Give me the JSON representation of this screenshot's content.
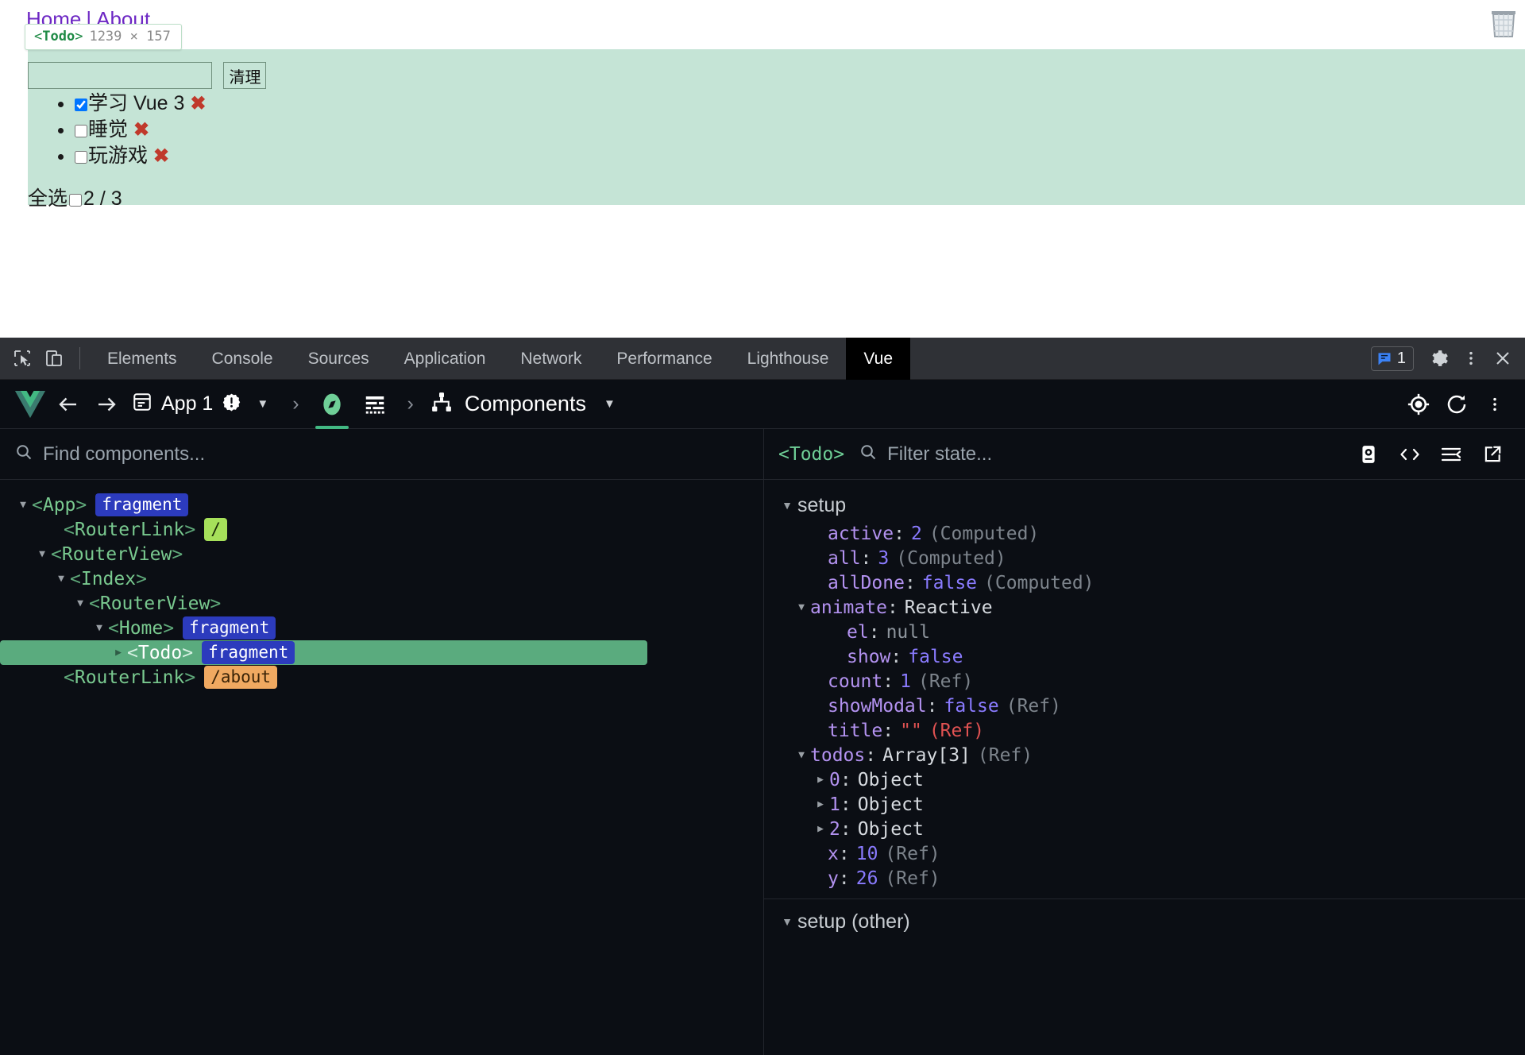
{
  "page": {
    "nav": {
      "home": "Home",
      "separator": "|",
      "about": "About"
    },
    "inspect_tooltip": {
      "tag_open": "<",
      "tag_name": "Todo",
      "tag_close": ">",
      "dimensions": "1239 × 157"
    },
    "todo": {
      "input_value": "",
      "input_placeholder": "",
      "clear_button": "清理",
      "items": [
        {
          "label": "学习 Vue 3",
          "done": true,
          "delete_icon": "✖"
        },
        {
          "label": "睡觉",
          "done": false,
          "delete_icon": "✖"
        },
        {
          "label": "玩游戏",
          "done": false,
          "delete_icon": "✖"
        }
      ],
      "select_all_label": "全选",
      "select_all_checked": false,
      "counter": "2 / 3"
    },
    "trash_icon": "trash-bin-icon",
    "highlight_color": "#c5e4d6"
  },
  "devtools": {
    "tabs": [
      {
        "label": "Elements",
        "active": false
      },
      {
        "label": "Console",
        "active": false
      },
      {
        "label": "Sources",
        "active": false
      },
      {
        "label": "Application",
        "active": false
      },
      {
        "label": "Network",
        "active": false
      },
      {
        "label": "Performance",
        "active": false
      },
      {
        "label": "Lighthouse",
        "active": false
      },
      {
        "label": "Vue",
        "active": true
      }
    ],
    "message_badge_count": "1",
    "icons": {
      "inspect": "cursor-select-icon",
      "device": "device-toolbar-icon",
      "messages": "message-icon",
      "settings": "gear-icon",
      "more": "more-vertical-icon",
      "close": "close-icon"
    }
  },
  "vue": {
    "logo": "vue-logo-icon",
    "back_icon": "arrow-left-icon",
    "forward_icon": "arrow-right-icon",
    "app_icon": "app-window-icon",
    "app_label": "App 1",
    "app_warning_icon": "warning-badge-icon",
    "app_dropdown_icon": "chevron-down-icon",
    "breadcrumb_chevron": "›",
    "compass_icon": "compass-icon",
    "timeline_icon": "timeline-icon",
    "view_icon": "component-tree-icon",
    "view_label": "Components",
    "view_dropdown_icon": "chevron-down-icon",
    "target_icon": "crosshair-target-icon",
    "refresh_icon": "refresh-icon",
    "more_icon": "more-vertical-icon",
    "left": {
      "search_placeholder": "Find components...",
      "search_value": "",
      "search_icon": "search-icon",
      "tree": [
        {
          "depth": 0,
          "caret": "down",
          "name": "App",
          "badge": "fragment",
          "badge_kind": "fragment",
          "selected": false
        },
        {
          "depth": 1,
          "caret": "none",
          "name": "RouterLink",
          "badge": "/",
          "badge_kind": "route-root",
          "selected": false
        },
        {
          "depth": 1,
          "caret": "down",
          "name": "RouterView",
          "badge": "",
          "badge_kind": "",
          "selected": false
        },
        {
          "depth": 2,
          "caret": "down",
          "name": "Index",
          "badge": "",
          "badge_kind": "",
          "selected": false
        },
        {
          "depth": 3,
          "caret": "down",
          "name": "RouterView",
          "badge": "",
          "badge_kind": "",
          "selected": false
        },
        {
          "depth": 4,
          "caret": "down",
          "name": "Home",
          "badge": "fragment",
          "badge_kind": "fragment",
          "selected": false
        },
        {
          "depth": 5,
          "caret": "right",
          "name": "Todo",
          "badge": "fragment",
          "badge_kind": "fragment",
          "selected": true
        },
        {
          "depth": 1,
          "caret": "none",
          "name": "RouterLink",
          "badge": "/about",
          "badge_kind": "route-about",
          "selected": false
        }
      ]
    },
    "right": {
      "selected_component": "<Todo>",
      "filter_placeholder": "Filter state...",
      "filter_value": "",
      "search_icon": "search-icon",
      "actions": [
        {
          "name": "inspect-dom-icon"
        },
        {
          "name": "open-in-editor-code-icon"
        },
        {
          "name": "collapse-all-icon"
        },
        {
          "name": "open-external-icon"
        }
      ],
      "groups": [
        {
          "title": "setup",
          "caret": "down",
          "rows": [
            {
              "depth": 1,
              "caret": "none",
              "key": "active",
              "value": "2",
              "value_kind": "num",
              "meta": "(Computed)",
              "meta_kind": "gray"
            },
            {
              "depth": 1,
              "caret": "none",
              "key": "all",
              "value": "3",
              "value_kind": "num",
              "meta": "(Computed)",
              "meta_kind": "gray"
            },
            {
              "depth": 1,
              "caret": "none",
              "key": "allDone",
              "value": "false",
              "value_kind": "bool",
              "meta": "(Computed)",
              "meta_kind": "gray"
            },
            {
              "depth": 1,
              "caret": "down",
              "key": "animate",
              "value": "Reactive",
              "value_kind": "plain",
              "meta": "",
              "meta_kind": "gray"
            },
            {
              "depth": 2,
              "caret": "none",
              "key": "el",
              "value": "null",
              "value_kind": "null",
              "meta": "",
              "meta_kind": "gray"
            },
            {
              "depth": 2,
              "caret": "none",
              "key": "show",
              "value": "false",
              "value_kind": "bool",
              "meta": "",
              "meta_kind": "gray"
            },
            {
              "depth": 1,
              "caret": "none",
              "key": "count",
              "value": "1",
              "value_kind": "num",
              "meta": "(Ref)",
              "meta_kind": "gray"
            },
            {
              "depth": 1,
              "caret": "none",
              "key": "showModal",
              "value": "false",
              "value_kind": "bool",
              "meta": "(Ref)",
              "meta_kind": "gray"
            },
            {
              "depth": 1,
              "caret": "none",
              "key": "title",
              "value": "\"\"",
              "value_kind": "str",
              "meta": "(Ref)",
              "meta_kind": "red"
            },
            {
              "depth": 1,
              "caret": "down",
              "key": "todos",
              "value": "Array[3]",
              "value_kind": "plain",
              "meta": "(Ref)",
              "meta_kind": "gray"
            },
            {
              "depth": 2,
              "caret": "right",
              "key": "0",
              "value": "Object",
              "value_kind": "plain",
              "meta": "",
              "meta_kind": "gray"
            },
            {
              "depth": 2,
              "caret": "right",
              "key": "1",
              "value": "Object",
              "value_kind": "plain",
              "meta": "",
              "meta_kind": "gray"
            },
            {
              "depth": 2,
              "caret": "right",
              "key": "2",
              "value": "Object",
              "value_kind": "plain",
              "meta": "",
              "meta_kind": "gray"
            },
            {
              "depth": 1,
              "caret": "none",
              "key": "x",
              "value": "10",
              "value_kind": "num",
              "meta": "(Ref)",
              "meta_kind": "gray"
            },
            {
              "depth": 1,
              "caret": "none",
              "key": "y",
              "value": "26",
              "value_kind": "num",
              "meta": "(Ref)",
              "meta_kind": "gray"
            }
          ]
        },
        {
          "title": "setup (other)",
          "caret": "down",
          "rows": []
        }
      ]
    }
  },
  "colors": {
    "vue_green": "#42b883",
    "selection_green": "#5aab7e",
    "fragment_blue": "#2c3bbd",
    "route_root_green": "#a6e05a",
    "route_about_orange": "#f0a961",
    "string_red": "#e05252",
    "key_purple": "#b392f0",
    "devtools_bg": "#0b0e14",
    "tabstrip_bg": "#2f3136"
  }
}
